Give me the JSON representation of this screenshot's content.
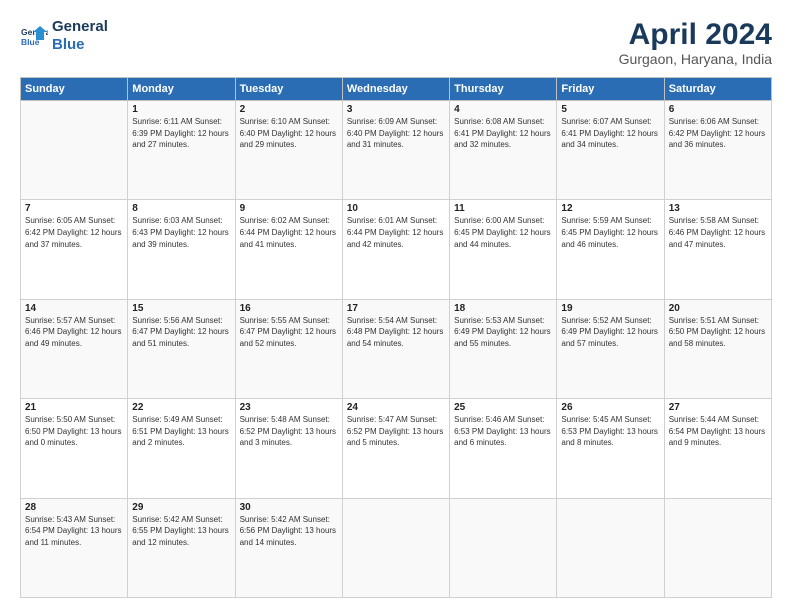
{
  "logo": {
    "line1": "General",
    "line2": "Blue"
  },
  "title": "April 2024",
  "subtitle": "Gurgaon, Haryana, India",
  "days_of_week": [
    "Sunday",
    "Monday",
    "Tuesday",
    "Wednesday",
    "Thursday",
    "Friday",
    "Saturday"
  ],
  "weeks": [
    [
      {
        "day": "",
        "info": ""
      },
      {
        "day": "1",
        "info": "Sunrise: 6:11 AM\nSunset: 6:39 PM\nDaylight: 12 hours\nand 27 minutes."
      },
      {
        "day": "2",
        "info": "Sunrise: 6:10 AM\nSunset: 6:40 PM\nDaylight: 12 hours\nand 29 minutes."
      },
      {
        "day": "3",
        "info": "Sunrise: 6:09 AM\nSunset: 6:40 PM\nDaylight: 12 hours\nand 31 minutes."
      },
      {
        "day": "4",
        "info": "Sunrise: 6:08 AM\nSunset: 6:41 PM\nDaylight: 12 hours\nand 32 minutes."
      },
      {
        "day": "5",
        "info": "Sunrise: 6:07 AM\nSunset: 6:41 PM\nDaylight: 12 hours\nand 34 minutes."
      },
      {
        "day": "6",
        "info": "Sunrise: 6:06 AM\nSunset: 6:42 PM\nDaylight: 12 hours\nand 36 minutes."
      }
    ],
    [
      {
        "day": "7",
        "info": "Sunrise: 6:05 AM\nSunset: 6:42 PM\nDaylight: 12 hours\nand 37 minutes."
      },
      {
        "day": "8",
        "info": "Sunrise: 6:03 AM\nSunset: 6:43 PM\nDaylight: 12 hours\nand 39 minutes."
      },
      {
        "day": "9",
        "info": "Sunrise: 6:02 AM\nSunset: 6:44 PM\nDaylight: 12 hours\nand 41 minutes."
      },
      {
        "day": "10",
        "info": "Sunrise: 6:01 AM\nSunset: 6:44 PM\nDaylight: 12 hours\nand 42 minutes."
      },
      {
        "day": "11",
        "info": "Sunrise: 6:00 AM\nSunset: 6:45 PM\nDaylight: 12 hours\nand 44 minutes."
      },
      {
        "day": "12",
        "info": "Sunrise: 5:59 AM\nSunset: 6:45 PM\nDaylight: 12 hours\nand 46 minutes."
      },
      {
        "day": "13",
        "info": "Sunrise: 5:58 AM\nSunset: 6:46 PM\nDaylight: 12 hours\nand 47 minutes."
      }
    ],
    [
      {
        "day": "14",
        "info": "Sunrise: 5:57 AM\nSunset: 6:46 PM\nDaylight: 12 hours\nand 49 minutes."
      },
      {
        "day": "15",
        "info": "Sunrise: 5:56 AM\nSunset: 6:47 PM\nDaylight: 12 hours\nand 51 minutes."
      },
      {
        "day": "16",
        "info": "Sunrise: 5:55 AM\nSunset: 6:47 PM\nDaylight: 12 hours\nand 52 minutes."
      },
      {
        "day": "17",
        "info": "Sunrise: 5:54 AM\nSunset: 6:48 PM\nDaylight: 12 hours\nand 54 minutes."
      },
      {
        "day": "18",
        "info": "Sunrise: 5:53 AM\nSunset: 6:49 PM\nDaylight: 12 hours\nand 55 minutes."
      },
      {
        "day": "19",
        "info": "Sunrise: 5:52 AM\nSunset: 6:49 PM\nDaylight: 12 hours\nand 57 minutes."
      },
      {
        "day": "20",
        "info": "Sunrise: 5:51 AM\nSunset: 6:50 PM\nDaylight: 12 hours\nand 58 minutes."
      }
    ],
    [
      {
        "day": "21",
        "info": "Sunrise: 5:50 AM\nSunset: 6:50 PM\nDaylight: 13 hours\nand 0 minutes."
      },
      {
        "day": "22",
        "info": "Sunrise: 5:49 AM\nSunset: 6:51 PM\nDaylight: 13 hours\nand 2 minutes."
      },
      {
        "day": "23",
        "info": "Sunrise: 5:48 AM\nSunset: 6:52 PM\nDaylight: 13 hours\nand 3 minutes."
      },
      {
        "day": "24",
        "info": "Sunrise: 5:47 AM\nSunset: 6:52 PM\nDaylight: 13 hours\nand 5 minutes."
      },
      {
        "day": "25",
        "info": "Sunrise: 5:46 AM\nSunset: 6:53 PM\nDaylight: 13 hours\nand 6 minutes."
      },
      {
        "day": "26",
        "info": "Sunrise: 5:45 AM\nSunset: 6:53 PM\nDaylight: 13 hours\nand 8 minutes."
      },
      {
        "day": "27",
        "info": "Sunrise: 5:44 AM\nSunset: 6:54 PM\nDaylight: 13 hours\nand 9 minutes."
      }
    ],
    [
      {
        "day": "28",
        "info": "Sunrise: 5:43 AM\nSunset: 6:54 PM\nDaylight: 13 hours\nand 11 minutes."
      },
      {
        "day": "29",
        "info": "Sunrise: 5:42 AM\nSunset: 6:55 PM\nDaylight: 13 hours\nand 12 minutes."
      },
      {
        "day": "30",
        "info": "Sunrise: 5:42 AM\nSunset: 6:56 PM\nDaylight: 13 hours\nand 14 minutes."
      },
      {
        "day": "",
        "info": ""
      },
      {
        "day": "",
        "info": ""
      },
      {
        "day": "",
        "info": ""
      },
      {
        "day": "",
        "info": ""
      }
    ]
  ]
}
